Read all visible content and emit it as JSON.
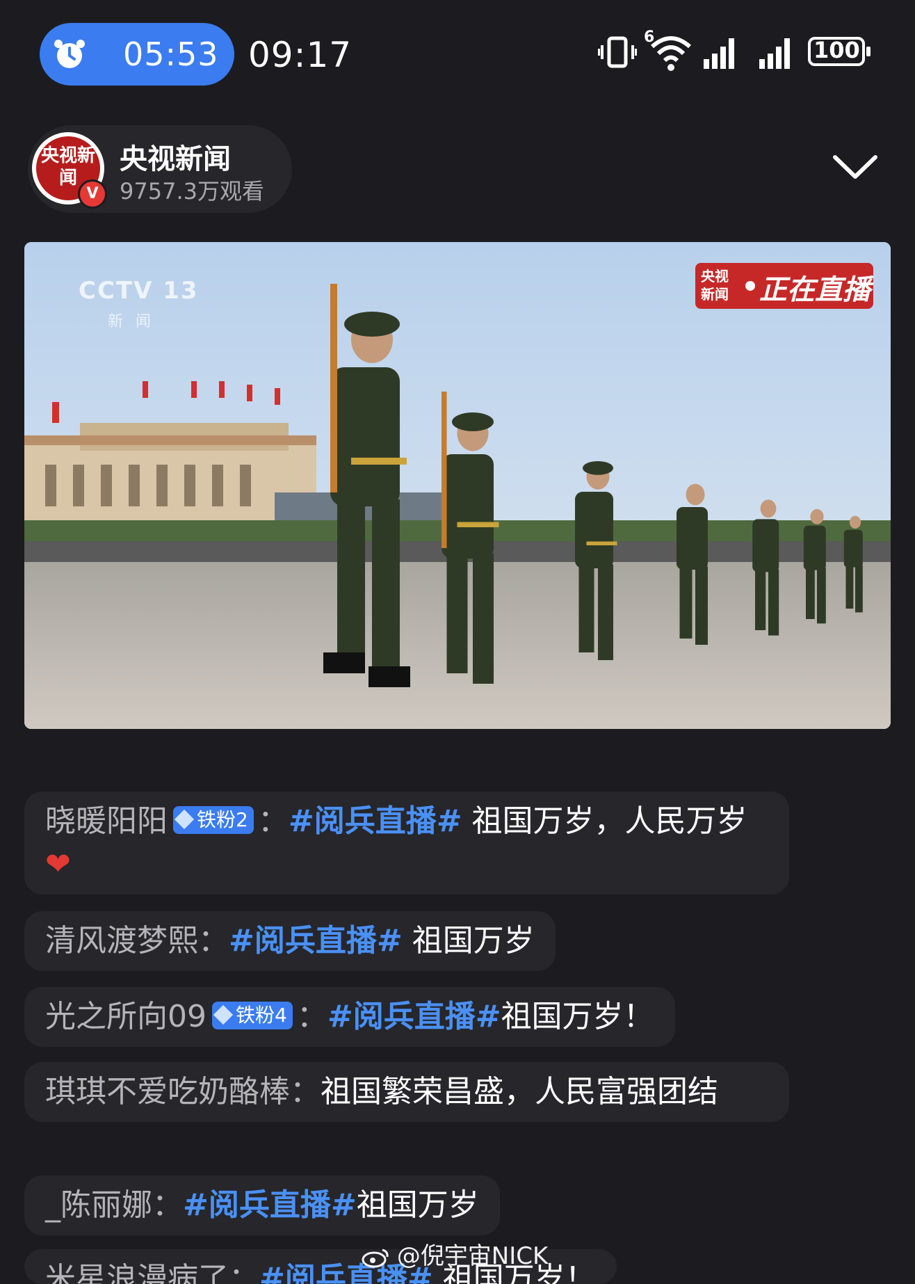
{
  "status_bar": {
    "alarm_time": "05:53",
    "clock": "09:17",
    "battery": "100",
    "network_label": "6"
  },
  "header": {
    "channel_logo_text": "央视新闻",
    "channel_name": "央视新闻",
    "view_count": "9757.3万观看",
    "verified_mark": "V"
  },
  "video": {
    "watermark_channel": "CCTV 13",
    "watermark_sub": "新闻",
    "live_logo": "央视新闻",
    "live_label": "正在直播"
  },
  "comments": [
    {
      "user": "晓暖阳阳",
      "badge": "铁粉2",
      "sep": "：",
      "tag": "#阅兵直播#",
      "text": " 祖国万岁，人民万岁",
      "emoji": "❤"
    },
    {
      "user": "清风渡梦熙",
      "badge": "",
      "sep": "：",
      "tag": "#阅兵直播#",
      "text": " 祖国万岁",
      "emoji": ""
    },
    {
      "user": "光之所向09",
      "badge": "铁粉4",
      "sep": "：",
      "tag": "#阅兵直播#",
      "text": "祖国万岁！",
      "emoji": ""
    },
    {
      "user": "琪琪不爱吃奶酪棒",
      "badge": "",
      "sep": "：",
      "tag": "",
      "text": "祖国繁荣昌盛，人民富强团结",
      "emoji": ""
    },
    {
      "user": "_陈丽娜",
      "badge": "",
      "sep": "：",
      "tag": "#阅兵直播#",
      "text": "祖国万岁",
      "emoji": ""
    },
    {
      "user": "米星浪漫病了",
      "badge": "",
      "sep": "：",
      "tag": "#阅兵直播#",
      "text": " 祖国万岁！",
      "emoji": ""
    }
  ],
  "watermark": "@倪宇宙NICK",
  "colors": {
    "accent": "#3b7cf0",
    "hashtag": "#4a90f5",
    "background": "#1c1c20",
    "live_red": "#c62828"
  }
}
